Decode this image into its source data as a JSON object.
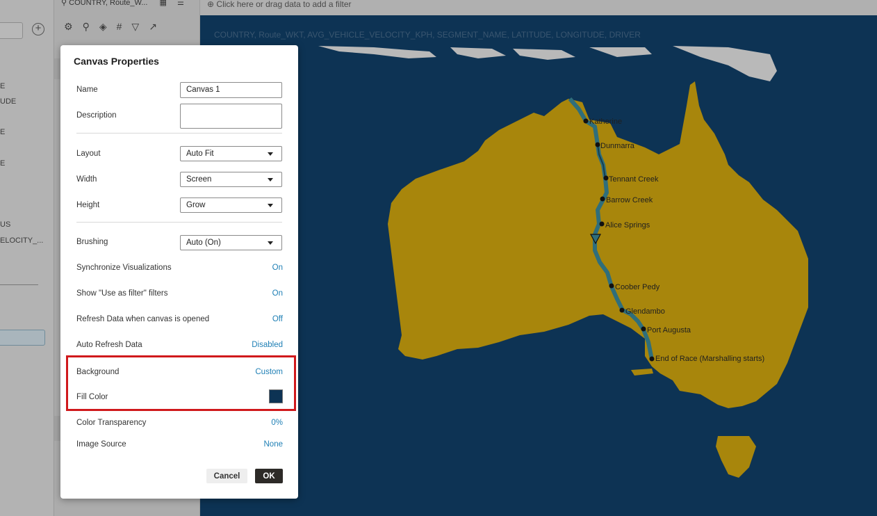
{
  "colors": {
    "canvas_bg": "#0d3354",
    "land": "#a8860c",
    "route": "#2f6e7b",
    "accent": "#1e7fb5",
    "highlight": "#d0191c"
  },
  "left_panel": {
    "fragments": [
      "E",
      "UDE",
      "E",
      "E",
      "US",
      "ELOCITY_..."
    ]
  },
  "data_panel": {
    "tab_label": "COUNTRY, Route_W...",
    "toolbar_icons": [
      "gear-icon",
      "pin-icon",
      "layers-icon",
      "hash-icon",
      "filter-icon",
      "trend-icon"
    ]
  },
  "filterbar": {
    "placeholder": "Click here or drag data to add a filter"
  },
  "viz": {
    "title": "COUNTRY, Route_WKT, AVG_VEHICLE_VELOCITY_KPH, SEGMENT_NAME, LATITUDE, LONGITUDE, DRIVER",
    "cities": [
      "Katherine",
      "Dunmarra",
      "Tennant Creek",
      "Barrow Creek",
      "Alice Springs",
      "Coober Pedy",
      "Glendambo",
      "Port Augusta",
      "End of Race (Marshalling starts)"
    ]
  },
  "dialog": {
    "title": "Canvas Properties",
    "name_label": "Name",
    "name_value": "Canvas 1",
    "description_label": "Description",
    "description_value": "",
    "layout_label": "Layout",
    "layout_value": "Auto Fit",
    "width_label": "Width",
    "width_value": "Screen",
    "height_label": "Height",
    "height_value": "Grow",
    "brushing_label": "Brushing",
    "brushing_value": "Auto (On)",
    "sync_label": "Synchronize Visualizations",
    "sync_value": "On",
    "filters_label": "Show \"Use as filter\" filters",
    "filters_value": "On",
    "refresh_label": "Refresh Data when canvas is opened",
    "refresh_value": "Off",
    "autorefresh_label": "Auto Refresh Data",
    "autorefresh_value": "Disabled",
    "background_label": "Background",
    "background_value": "Custom",
    "fill_label": "Fill Color",
    "fill_value": "#0d3354",
    "transparency_label": "Color Transparency",
    "transparency_value": "0%",
    "image_label": "Image Source",
    "image_value": "None",
    "cancel_label": "Cancel",
    "ok_label": "OK"
  }
}
